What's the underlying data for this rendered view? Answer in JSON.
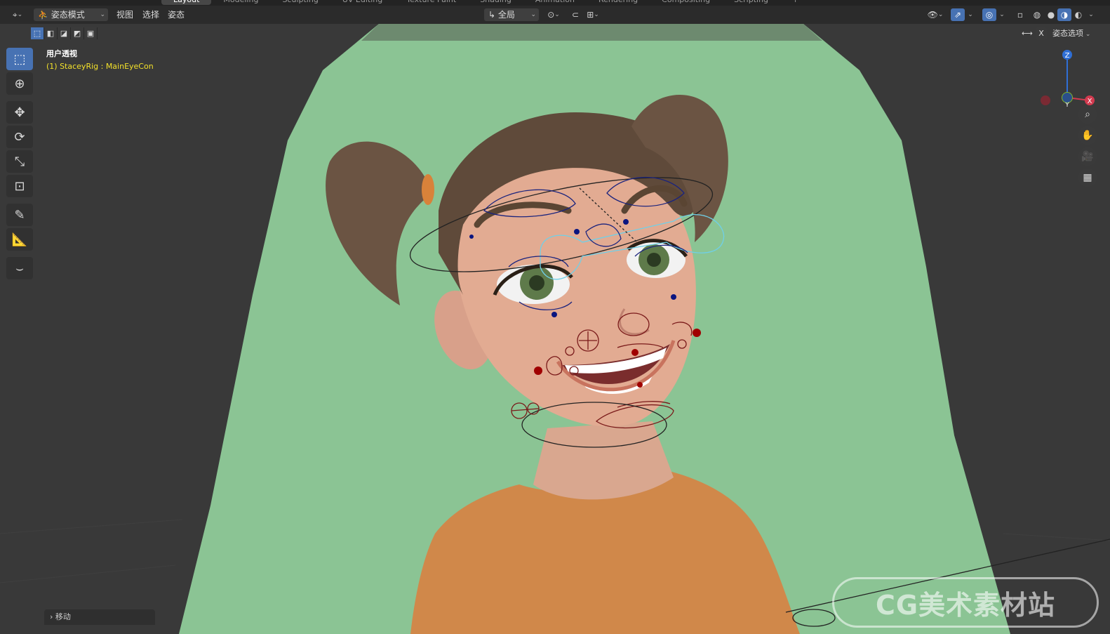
{
  "workspace_tabs": [
    "Layout",
    "Modeling",
    "Sculpting",
    "UV Editing",
    "Texture Paint",
    "Shading",
    "Animation",
    "Rendering",
    "Compositing",
    "Scripting",
    "+"
  ],
  "header": {
    "mode": "姿态模式",
    "menus": [
      "视图",
      "选择",
      "姿态"
    ],
    "transform_orientation": "全局"
  },
  "pose_options_label": "姿态选项",
  "mirror_x": "X",
  "viewport": {
    "view_name": "用户透视",
    "active_object": "(1) StaceyRig : MainEyeCon"
  },
  "gizmo": {
    "z": "Z",
    "y": "Y",
    "x": "X"
  },
  "last_operator": "移动",
  "watermark": "CG美术素材站",
  "colors": {
    "accent": "#4772b3",
    "background_green": "#8bc494",
    "shirt": "#d0884a",
    "skin": "#dfa98e",
    "hair": "#5f4a3a",
    "info_yellow": "#f2e02a"
  },
  "icons": {
    "toolbar": [
      "select-box-icon",
      "cursor-icon",
      "move-icon",
      "rotate-icon",
      "scale-icon",
      "transform-icon",
      "annotate-icon",
      "measure-icon",
      "bone-curve-icon"
    ],
    "nav": [
      "zoom-icon",
      "pan-hand-icon",
      "camera-icon",
      "grid-view-icon"
    ]
  }
}
